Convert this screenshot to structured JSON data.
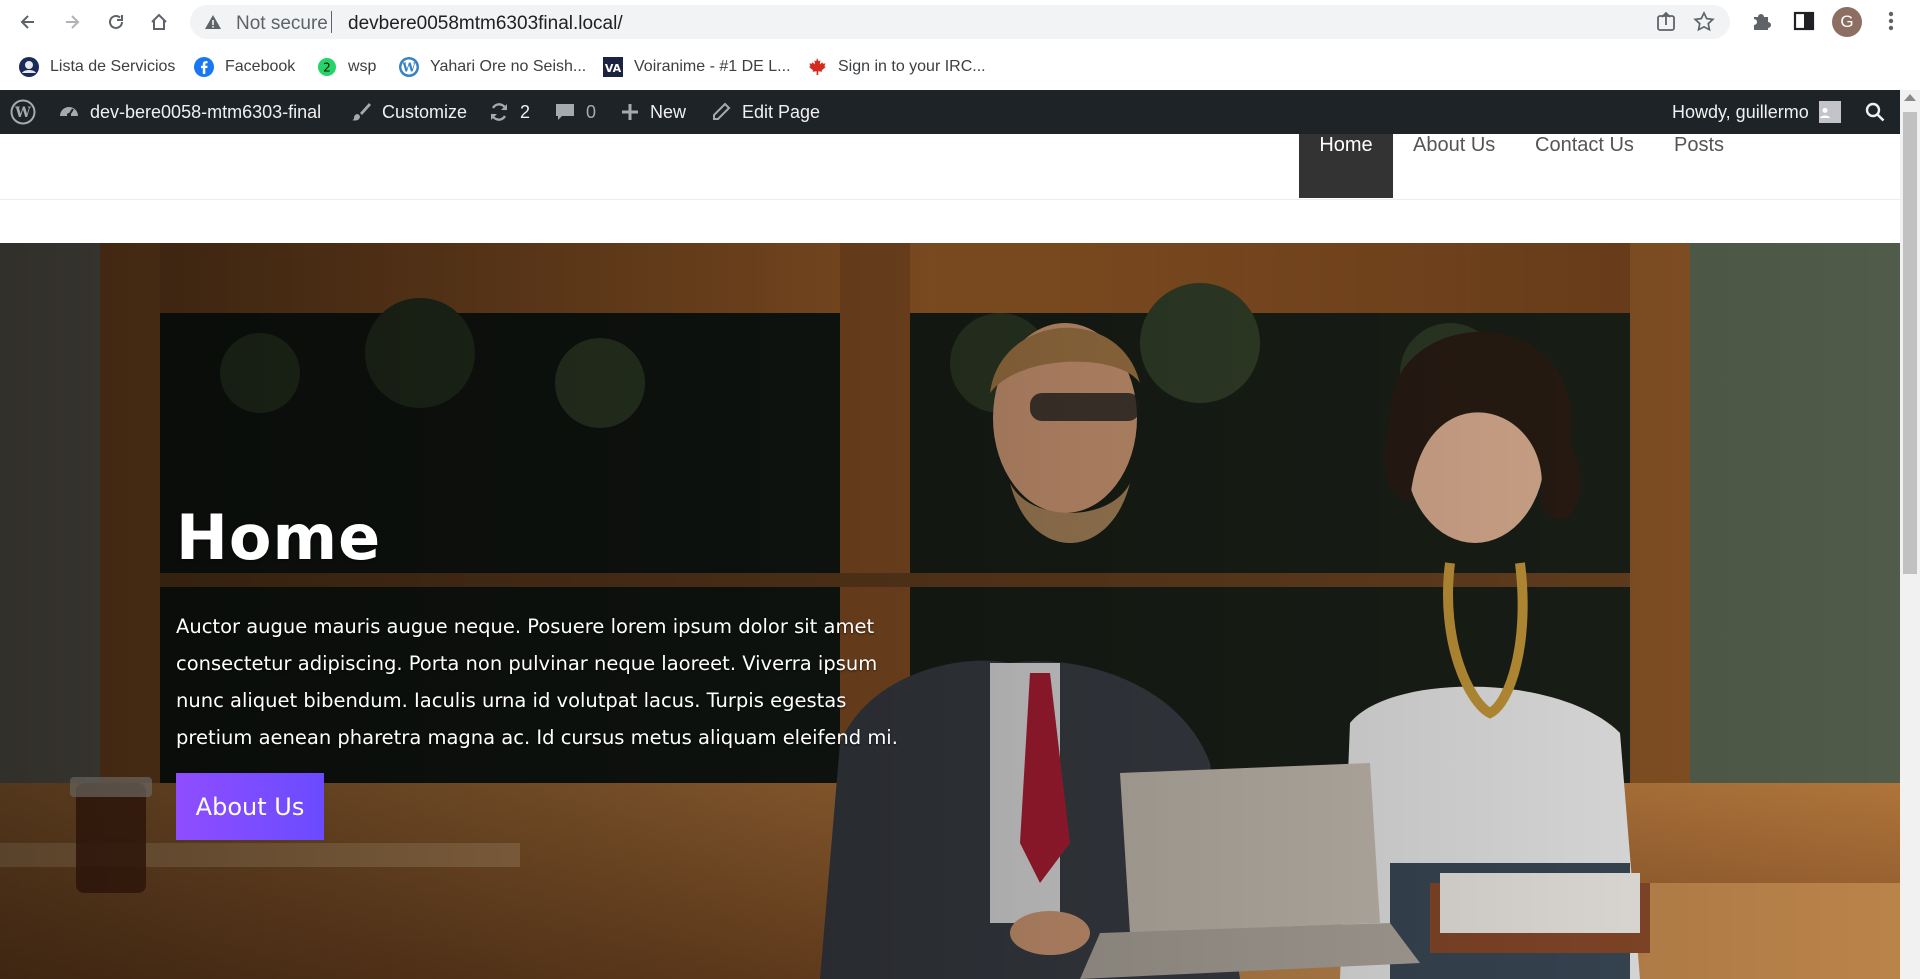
{
  "browser": {
    "security_label": "Not secure",
    "url": "devbere0058mtm6303final.local/",
    "profile_initial": "G",
    "icons": [
      "back-icon",
      "forward-icon",
      "reload-icon",
      "home-icon",
      "warning-icon",
      "share-icon",
      "star-icon",
      "extensions-icon",
      "side-panel-icon",
      "more-vert-icon"
    ],
    "bookmarks": [
      {
        "label": "Lista de Servicios",
        "icon": "globe-favicon"
      },
      {
        "label": "Facebook",
        "icon": "facebook-favicon"
      },
      {
        "label": "wsp",
        "icon": "whatsapp-favicon"
      },
      {
        "label": "Yahari Ore no Seish...",
        "icon": "wordpress-favicon"
      },
      {
        "label": "Voiranime - #1 DE L...",
        "icon": "voiranime-favicon"
      },
      {
        "label": "Sign in to your IRC...",
        "icon": "maple-leaf-favicon"
      }
    ]
  },
  "adminbar": {
    "site_name": "dev-bere0058-mtm6303-final",
    "customize": "Customize",
    "updates_count": "2",
    "comments_count": "0",
    "new": "New",
    "edit_page": "Edit Page",
    "howdy": "Howdy, guillermo",
    "colors": {
      "background": "#1d2327",
      "text": "#f0f0f1"
    }
  },
  "site": {
    "menu": [
      {
        "label": "Home",
        "active": true
      },
      {
        "label": "About Us",
        "active": false
      },
      {
        "label": "Contact Us",
        "active": false
      },
      {
        "label": "Posts",
        "active": false
      }
    ]
  },
  "hero": {
    "title": "Home",
    "paragraph": "Auctor augue mauris augue neque. Posuere lorem ipsum dolor sit amet consectetur adipiscing. Porta non pulvinar neque laoreet. Viverra ipsum nunc aliquet bibendum. Iaculis urna id volutpat lacus. Turpis egestas pretium aenean pharetra magna ac. Id cursus metus aliquam eleifend mi.",
    "button": "About Us",
    "colors": {
      "button_start": "#8f4dff",
      "button_end": "#6b4bff"
    }
  }
}
